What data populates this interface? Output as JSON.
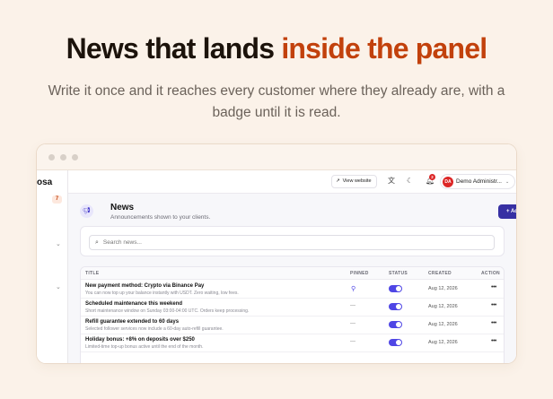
{
  "hero": {
    "title_main": "News that lands ",
    "title_accent": "inside the panel",
    "subtitle": "Write it once and it reaches every customer where they already are, with a badge until it is read.",
    "accent_color": "#c2410c"
  },
  "sidebar": {
    "brand": "osa",
    "badge_count": "7"
  },
  "topbar": {
    "view_website_label": "View website",
    "notification_count": "2",
    "avatar_initials": "DA",
    "user_name": "Demo Administr..."
  },
  "page": {
    "title": "News",
    "subtitle": "Announcements shown to your clients.",
    "add_button_label": "+ Add new"
  },
  "search": {
    "placeholder": "Search news..."
  },
  "table": {
    "columns": {
      "title": "TITLE",
      "pinned": "PINNED",
      "status": "STATUS",
      "created": "CREATED",
      "action": "ACTION"
    },
    "rows": [
      {
        "title": "New payment method: Crypto via Binance Pay",
        "subtitle": "You can now top up your balance instantly with USDT. Zero waiting, low fees.",
        "pinned": true,
        "pinned_text": "",
        "status_on": true,
        "created": "Aug 12, 2026"
      },
      {
        "title": "Scheduled maintenance this weekend",
        "subtitle": "Short maintenance window on Sunday 03:00-04:00 UTC. Orders keep processing.",
        "pinned": false,
        "pinned_text": "—",
        "status_on": true,
        "created": "Aug 12, 2026"
      },
      {
        "title": "Refill guarantee extended to 60 days",
        "subtitle": "Selected follower services now include a 60-day auto-refill guarantee.",
        "pinned": false,
        "pinned_text": "—",
        "status_on": true,
        "created": "Aug 12, 2026"
      },
      {
        "title": "Holiday bonus: +8% on deposits over $250",
        "subtitle": "Limited-time top-up bonus active until the end of the month.",
        "pinned": false,
        "pinned_text": "—",
        "status_on": true,
        "created": "Aug 12, 2026"
      }
    ]
  },
  "colors": {
    "primary": "#3730a3",
    "toggle_on": "#4f46e5",
    "background": "#fbf2e9"
  }
}
